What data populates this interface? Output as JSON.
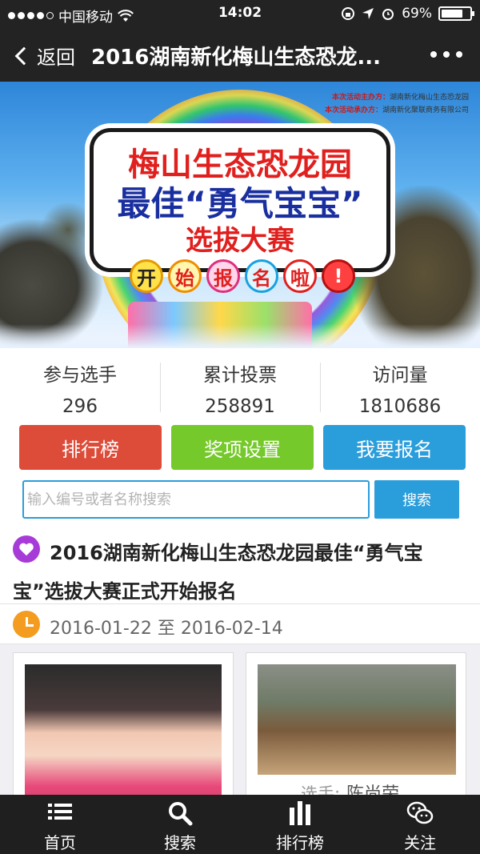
{
  "status_bar": {
    "carrier": "中国移动",
    "time": "14:02",
    "battery": "69%"
  },
  "nav": {
    "back_label": "返回",
    "title": "2016湖南新化梅山生态恐龙..."
  },
  "banner": {
    "organizer_label": "本次活动主办方：",
    "organizer": "湖南新化梅山生态恐龙园",
    "undertaker_label": "本次活动承办方：",
    "undertaker": "湖南新化聚联商务有限公司",
    "line1": "梅山生态恐龙园",
    "line2": "最佳“勇气宝宝”",
    "line3": "选拔大赛",
    "chars": [
      "开",
      "始",
      "报",
      "名",
      "啦",
      "!"
    ]
  },
  "stats": [
    {
      "label": "参与选手",
      "value": "296"
    },
    {
      "label": "累计投票",
      "value": "258891"
    },
    {
      "label": "访问量",
      "value": "1810686"
    }
  ],
  "actions": {
    "ranking": "排行榜",
    "prizes": "奖项设置",
    "signup": "我要报名"
  },
  "search": {
    "placeholder": "输入编号或者名称搜索",
    "value": "",
    "button": "搜索"
  },
  "event": {
    "title": "2016湖南新化梅山生态恐龙园最佳“勇气宝宝”选拔大赛正式开始报名",
    "date_range": "2016-01-22 至 2016-02-14"
  },
  "cards": [
    {
      "player_label": "",
      "player_name": ""
    },
    {
      "player_label": "选手:",
      "player_name": "陈尚荣"
    }
  ],
  "tabbar": [
    {
      "label": "首页",
      "icon": "list-icon"
    },
    {
      "label": "搜索",
      "icon": "search-icon"
    },
    {
      "label": "排行榜",
      "icon": "bar-chart-icon"
    },
    {
      "label": "关注",
      "icon": "chat-icon"
    }
  ],
  "colors": {
    "ranking": "#dd4b39",
    "prizes": "#75c92a",
    "signup": "#2a9ddb",
    "nav_bg": "#232323"
  }
}
